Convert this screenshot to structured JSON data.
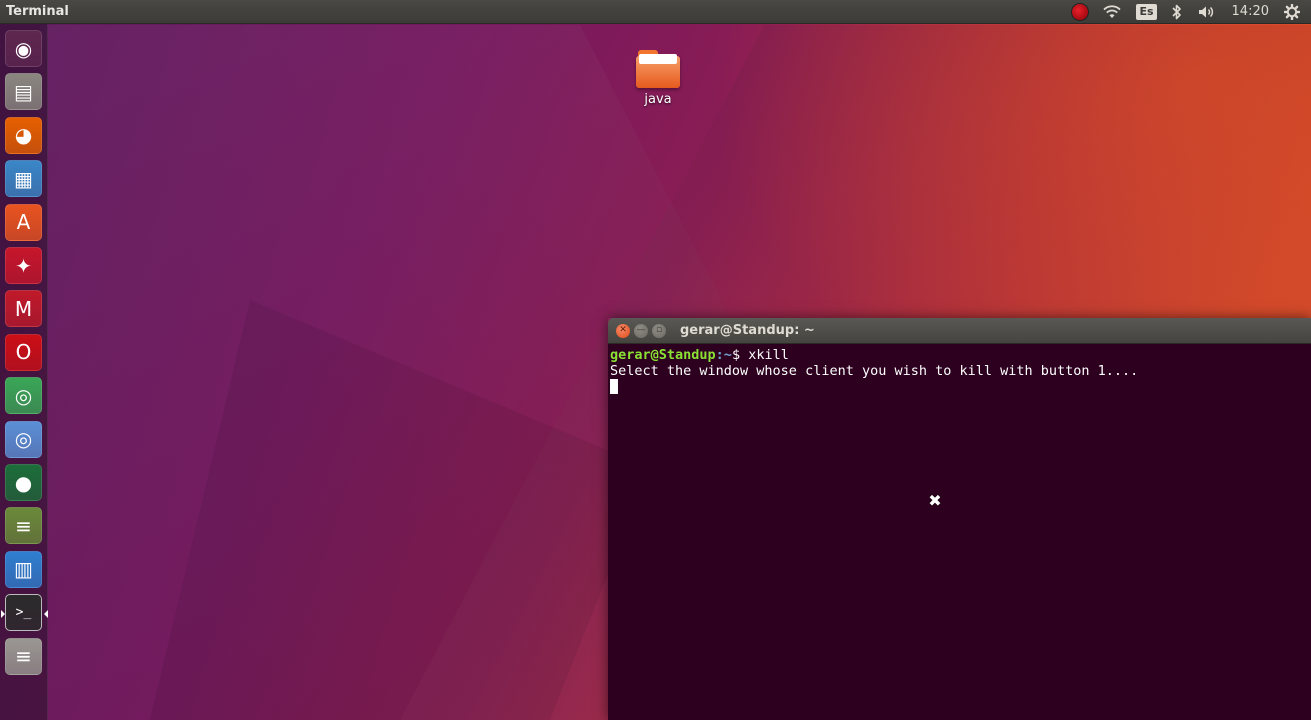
{
  "top_panel": {
    "app_title": "Terminal",
    "keyboard_layout": "Es",
    "clock": "14:20"
  },
  "icons": {
    "record": "record-icon",
    "wifi": "wifi-icon",
    "keyboard": "keyboard-layout-icon",
    "bluetooth": "bluetooth-icon",
    "volume": "volume-icon",
    "settings": "gear-icon"
  },
  "launcher": {
    "items": [
      {
        "name": "dash-home",
        "glyph": "◉",
        "bg": "#5e2750"
      },
      {
        "name": "files",
        "glyph": "▤",
        "bg": "#8a8780"
      },
      {
        "name": "firefox",
        "glyph": "◕",
        "bg": "#e66000"
      },
      {
        "name": "libreoffice-writer",
        "glyph": "▦",
        "bg": "#3a87c8"
      },
      {
        "name": "software-center",
        "glyph": "A",
        "bg": "#e95420"
      },
      {
        "name": "system-settings",
        "glyph": "✦",
        "bg": "#c7162b"
      },
      {
        "name": "app-mm",
        "glyph": "M",
        "bg": "#c01a2a"
      },
      {
        "name": "opera",
        "glyph": "O",
        "bg": "#cc0f16"
      },
      {
        "name": "chrome",
        "glyph": "◎",
        "bg": "#3aa757"
      },
      {
        "name": "chromium",
        "glyph": "◎",
        "bg": "#5b8fd6"
      },
      {
        "name": "globe-app",
        "glyph": "●",
        "bg": "#1c6e3a"
      },
      {
        "name": "stacked-apps",
        "glyph": "≡",
        "bg": "#6a8a3a"
      },
      {
        "name": "calendar-app",
        "glyph": "▥",
        "bg": "#2f7fd0"
      },
      {
        "name": "terminal",
        "glyph": ">_",
        "bg": "#2b2b2b"
      },
      {
        "name": "more-apps",
        "glyph": "≡",
        "bg": "#9a9892"
      }
    ]
  },
  "desktop": {
    "folder_label": "java"
  },
  "terminal": {
    "title": "gerar@Standup: ~",
    "prompt_user": "gerar@Standup",
    "prompt_path": ":~",
    "prompt_symbol": "$ ",
    "command": "xkill",
    "output_line": "Select the window whose client you wish to kill with button 1...."
  },
  "colors": {
    "terminal_bg": "#2c001e",
    "prompt_user": "#8ae234",
    "prompt_path": "#729fcf",
    "panel": "#3c3b37",
    "accent": "#e95420"
  }
}
